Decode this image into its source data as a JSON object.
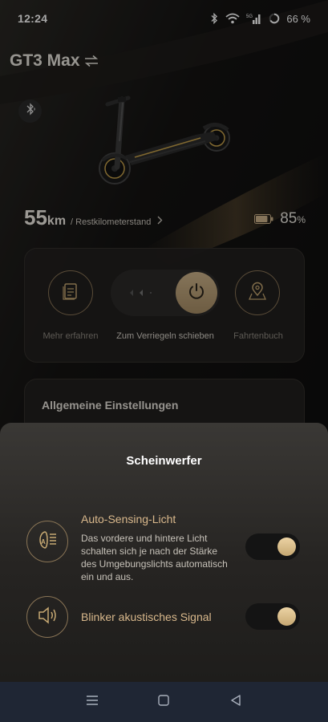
{
  "status": {
    "time": "12:24",
    "network": "5G",
    "battery": "66 %"
  },
  "header": {
    "model": "GT3 Max",
    "switch_icon": "swap-arrows-icon",
    "bluetooth_icon": "bluetooth-icon"
  },
  "stats": {
    "range_value": "55",
    "range_unit": "km",
    "range_label": "/ Restkilometerstand",
    "battery_value": "85",
    "battery_unit": "%",
    "battery_level": 0.85
  },
  "controls": {
    "info_label": "Mehr erfahren",
    "lock_label": "Zum Verriegeln schieben",
    "log_label": "Fahrtenbuch"
  },
  "settings": {
    "title": "Allgemeine Einstellungen"
  },
  "sheet": {
    "title": "Scheinwerfer",
    "options": [
      {
        "title": "Auto-Sensing-Licht",
        "description": "Das vordere und hintere Licht schalten sich je nach der Stärke des Umgebungslichts automatisch ein und aus.",
        "icon": "auto-headlight-icon",
        "enabled": true
      },
      {
        "title": "Blinker akustisches Signal",
        "description": "",
        "icon": "speaker-icon",
        "enabled": true
      }
    ]
  },
  "colors": {
    "accent_gold": "#c6a872",
    "background": "#0c0c0c",
    "nav_bar": "#1f2634"
  }
}
